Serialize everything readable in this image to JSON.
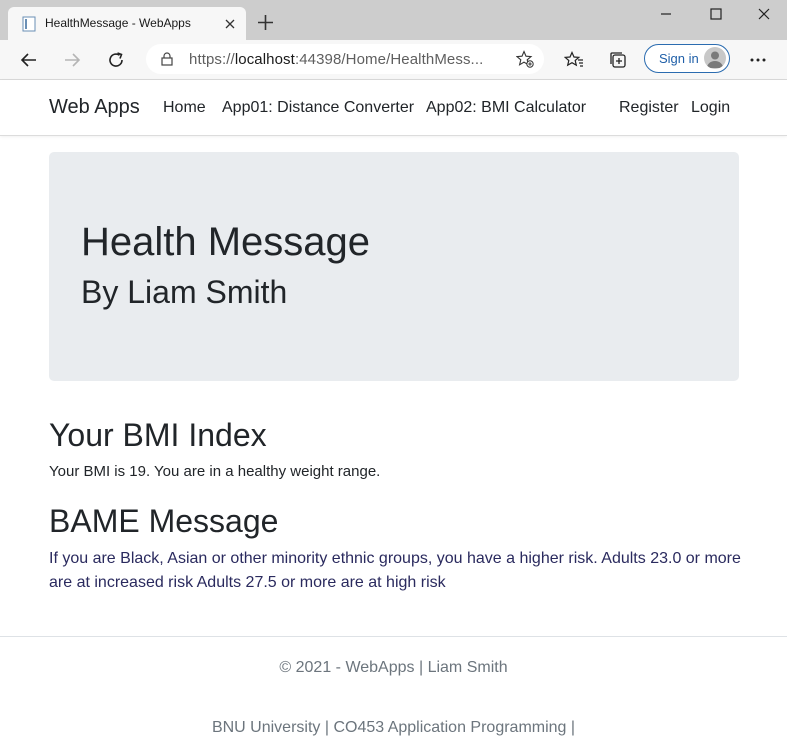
{
  "browser": {
    "tab_title": "HealthMessage - WebApps",
    "url_scheme": "https://",
    "url_host": "localhost",
    "url_rest": ":44398/Home/HealthMess...",
    "signin_label": "Sign in"
  },
  "nav": {
    "brand": "Web Apps",
    "links": [
      "Home",
      "App01: Distance Converter",
      "App02: BMI Calculator"
    ],
    "register": "Register",
    "login": "Login"
  },
  "jumbotron": {
    "title": "Health Message",
    "subtitle": "By Liam Smith"
  },
  "bmi": {
    "heading": "Your BMI Index",
    "text": "Your BMI is 19. You are in a healthy weight range."
  },
  "bame": {
    "heading": "BAME Message",
    "text": "If you are Black, Asian or other minority ethnic groups, you have a higher risk. Adults 23.0 or more are at increased risk Adults 27.5 or more are at high risk"
  },
  "footer": {
    "line1": "© 2021 - WebApps | Liam Smith",
    "line2": "BNU University | CO453 Application Programming |"
  },
  "colors": {
    "jumbotron_bg": "#e9ecef",
    "signin_border": "#2b6cb0",
    "bame_text": "#2a2a5e",
    "footer_text": "#6c757d"
  }
}
